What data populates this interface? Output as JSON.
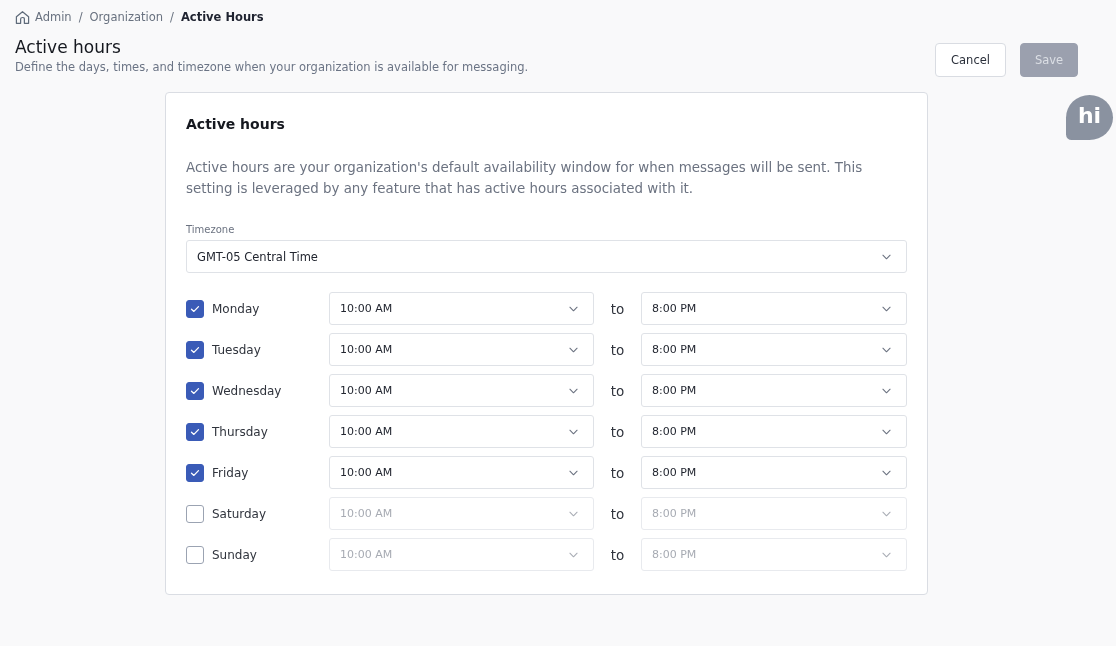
{
  "breadcrumb": [
    {
      "label": "Admin",
      "kind": "home",
      "current": false
    },
    {
      "label": "Organization",
      "separator": "/",
      "current": false
    },
    {
      "label": "Active Hours",
      "separator": "/",
      "current": true
    }
  ],
  "header": {
    "title": "Active hours",
    "description": "Define the days, times, and timezone when your organization is available for messaging."
  },
  "actions": [
    {
      "label": "Cancel",
      "kind": "secondary",
      "disabled": false
    },
    {
      "label": "Save",
      "kind": "primary",
      "disabled": true
    }
  ],
  "chat_widget": {
    "label": "hi"
  },
  "card": {
    "title": "Active hours",
    "description": "Active hours are your organization's default availability window for when messages will be sent. This setting is leveraged by any feature that has active hours associated with it.",
    "timezone": {
      "label": "Timezone",
      "value": "GMT-05 Central Time"
    },
    "schedule": [
      {
        "day": "Monday",
        "checked": true,
        "start": "10:00 AM",
        "separator": "to",
        "end": "8:00 PM"
      },
      {
        "day": "Tuesday",
        "checked": true,
        "start": "10:00 AM",
        "separator": "to",
        "end": "8:00 PM"
      },
      {
        "day": "Wednesday",
        "checked": true,
        "start": "10:00 AM",
        "separator": "to",
        "end": "8:00 PM"
      },
      {
        "day": "Thursday",
        "checked": true,
        "start": "10:00 AM",
        "separator": "to",
        "end": "8:00 PM"
      },
      {
        "day": "Friday",
        "checked": true,
        "start": "10:00 AM",
        "separator": "to",
        "end": "8:00 PM"
      },
      {
        "day": "Saturday",
        "checked": false,
        "start": "10:00 AM",
        "separator": "to",
        "end": "8:00 PM"
      },
      {
        "day": "Sunday",
        "checked": false,
        "start": "10:00 AM",
        "separator": "to",
        "end": "8:00 PM"
      }
    ]
  }
}
